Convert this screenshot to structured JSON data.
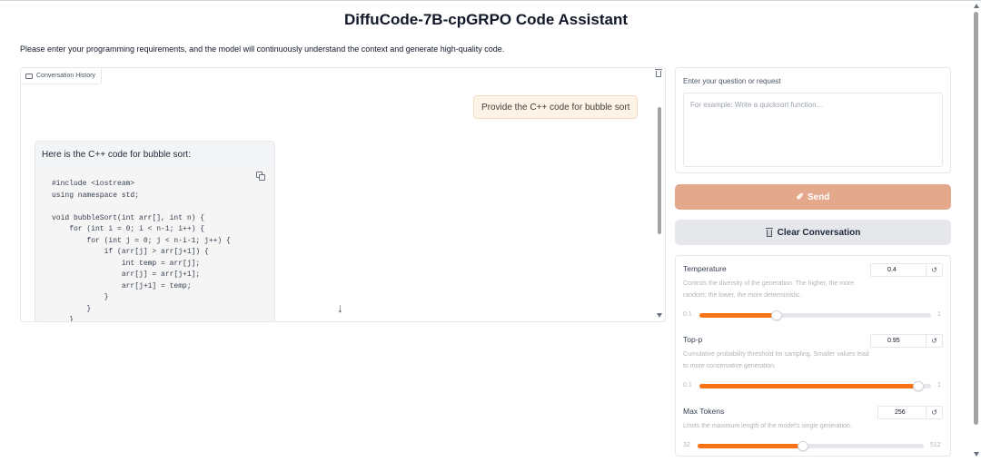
{
  "app": {
    "title": "DiffuCode-7B-cpGRPO Code Assistant",
    "description": "Please enter your programming requirements, and the model will continuously understand the context and generate high-quality code."
  },
  "chat": {
    "label": "Conversation History",
    "icons": {
      "label": "chat-icon",
      "clear": "trash-icon",
      "copy": "copy-icon",
      "jump": "arrow-down-icon"
    },
    "user_message": "Provide the C++ code for bubble sort",
    "bot_intro": "Here is the C++ code for bubble sort:",
    "code": "#include <iostream>\nusing namespace std;\n\nvoid bubbleSort(int arr[], int n) {\n    for (int i = 0; i < n-1; i++) {\n        for (int j = 0; j < n-i-1; j++) {\n            if (arr[j] > arr[j+1]) {\n                int temp = arr[j];\n                arr[j] = arr[j+1];\n                arr[j+1] = temp;\n            }\n        }\n    }",
    "scroll_arrow": "↓"
  },
  "input": {
    "label": "Enter your question or request",
    "placeholder": "For example: Write a quicksort function...",
    "value": ""
  },
  "buttons": {
    "send_label": "Send",
    "send_icon": "✐",
    "clear_label": "Clear Conversation"
  },
  "colors": {
    "send_button": "#e4a98c",
    "slider_fill": "#f97316",
    "user_bubble": "#fdf3e6"
  },
  "settings": {
    "reset_symbol": "↺",
    "temperature": {
      "label": "Temperature",
      "info": "Controls the diversity of the generation. The higher, the more random; the lower, the more deterministic.",
      "value": "0.4",
      "min": "0.1",
      "max": "1",
      "fraction": 0.333
    },
    "top_p": {
      "label": "Top-p",
      "info": "Cumulative probability threshold for sampling. Smaller values lead to more conservative generation.",
      "value": "0.95",
      "min": "0.1",
      "max": "1",
      "fraction": 0.944
    },
    "max_tokens": {
      "label": "Max Tokens",
      "info": "Limits the maximum length of the model's single generation.",
      "value": "256",
      "min": "32",
      "max": "512",
      "fraction": 0.467
    }
  }
}
